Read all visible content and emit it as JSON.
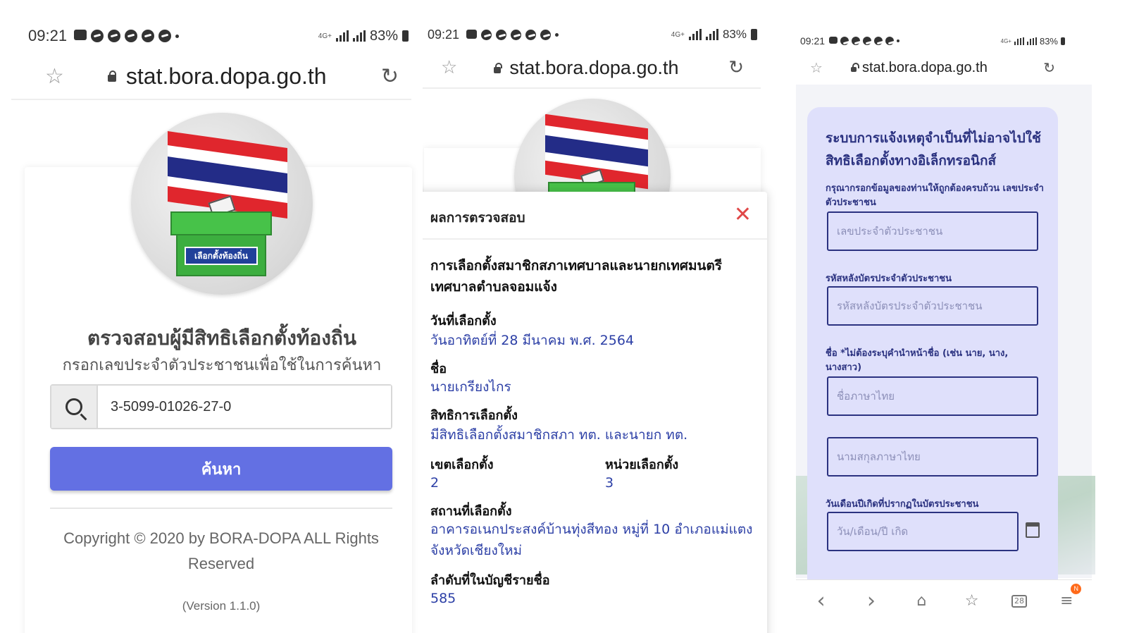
{
  "screens": [
    {
      "status": {
        "time": "09:21",
        "network": "4G+",
        "battery": "83%"
      },
      "url": "stat.bora.dopa.go.th",
      "logo": {
        "box_label": "เลือกตั้งท้องถิ่น"
      },
      "title": "ตรวจสอบผู้มีสิทธิเลือกตั้งท้องถิ่น",
      "subtitle": "กรอกเลขประจำตัวประชาชนเพื่อใช้ในการค้นหา",
      "search_value": "3-5099-01026-27-0",
      "search_button": "ค้นหา",
      "copyright": "Copyright © 2020 by BORA-DOPA ALL Rights Reserved",
      "version": "(Version 1.1.0)"
    },
    {
      "status": {
        "time": "09:21",
        "network": "4G+",
        "battery": "83%"
      },
      "url": "stat.bora.dopa.go.th",
      "modal": {
        "title": "ผลการตรวจสอบ",
        "close": "✕",
        "election": "การเลือกตั้งสมาชิกสภาเทศบาลและนายกเทศมนตรี เทศบาลตำบลจอมแจ้ง",
        "fields": {
          "date_label": "วันที่เลือกตั้ง",
          "date_value": "วันอาทิตย์ที่ 28 มีนาคม พ.ศ. 2564",
          "name_label": "ชื่อ",
          "name_value": "นายเกรียงไกร",
          "right_label": "สิทธิการเลือกตั้ง",
          "right_value": "มีสิทธิเลือกตั้งสมาชิกสภา ทต. และนายก ทต.",
          "district_label": "เขตเลือกตั้ง",
          "district_value": "2",
          "unit_label": "หน่วยเลือกตั้ง",
          "unit_value": "3",
          "place_label": "สถานที่เลือกตั้ง",
          "place_value": "อาคารอเนกประสงค์บ้านทุ่งสีทอง หมู่ที่ 10 อำเภอแม่แตง จังหวัดเชียงใหม่",
          "order_label": "ลำดับที่ในบัญชีรายชื่อ",
          "order_value": "585"
        }
      }
    },
    {
      "status": {
        "time": "09:21",
        "network": "4G+",
        "battery": "83%"
      },
      "url": "stat.bora.dopa.go.th",
      "form": {
        "title": "ระบบการแจ้งเหตุจำเป็นที่ไม่อาจไปใช้สิทธิเลือกตั้งทางอิเล็กทรอนิกส์",
        "label_id": "กรุณากรอกข้อมูลของท่านให้ถูกต้องครบถ้วน เลขประจำตัวประชาชน",
        "placeholder_id": "เลขประจำตัวประชาชน",
        "label_laser": "รหัสหลังบัตรประจำตัวประชาชน",
        "placeholder_laser": "รหัสหลังบัตรประจำตัวประชาชน",
        "label_name": "ชื่อ *ไม่ต้องระบุคำนำหน้าชื่อ (เช่น นาย, นาง, นางสาว)",
        "placeholder_firstname": "ชื่อภาษาไทย",
        "placeholder_lastname": "นามสกุลภาษาไทย",
        "label_dob": "วันเดือนปีเกิดที่ปรากฏในบัตรประชาชน",
        "placeholder_dob": "วัน/เดือน/ปี เกิด"
      },
      "nav": {
        "back": "‹",
        "forward": "›",
        "home": "⌂",
        "bookmarks": "☆",
        "tabs": "28",
        "menu": "≡",
        "menu_badge": "N"
      }
    }
  ],
  "colors": {
    "primary_button": "#6370e3",
    "value_text": "#2c3fa6",
    "close": "#e04848",
    "form_bg": "#dfe0fb",
    "form_text": "#2b3280"
  }
}
